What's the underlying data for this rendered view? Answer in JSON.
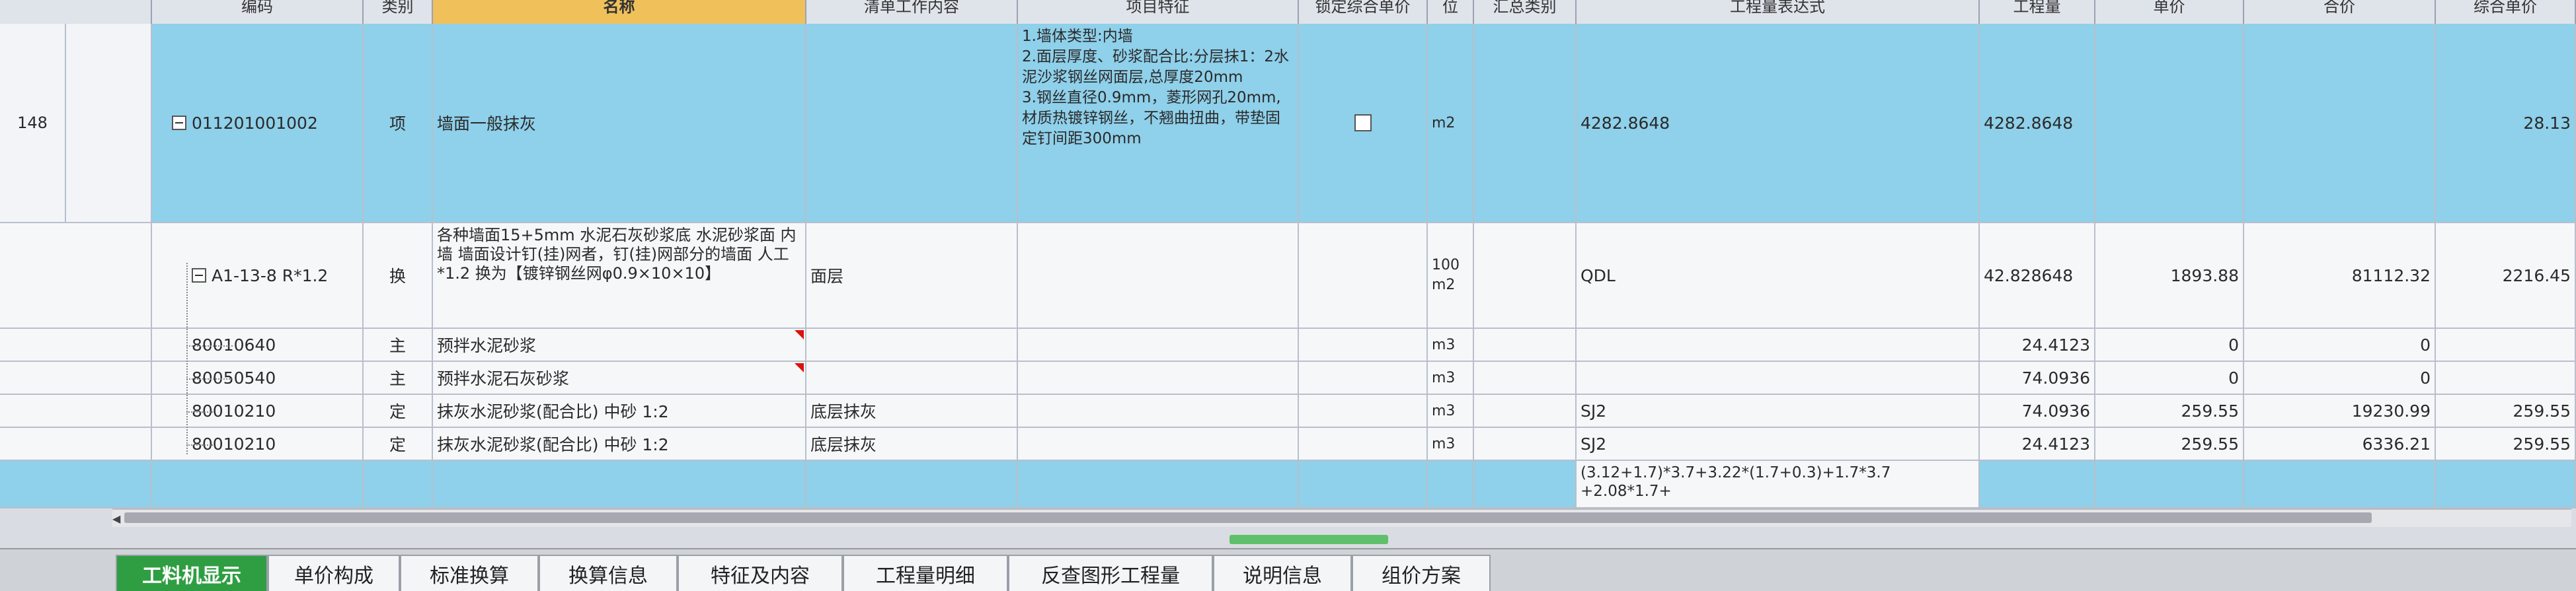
{
  "header": {
    "code": "编码",
    "category": "类别",
    "name": "名称",
    "work_content": "清单工作内容",
    "feature": "项目特征",
    "locked_price": "锁定综合单价",
    "unit": "位",
    "summary_category": "汇总类别",
    "quantity_expr": "工程量表达式",
    "quantity": "工程量",
    "unit_price": "单价",
    "total": "合价",
    "composite_price": "综合单价"
  },
  "rows": [
    {
      "index": "148",
      "code": "011201001002",
      "category": "项",
      "name": "墙面一般抹灰",
      "work_content": "",
      "feature": "1.墙体类型:内墙\n2.面层厚度、砂浆配合比:分层抹1：2水泥沙浆钢丝网面层,总厚度20mm\n3.钢丝直径0.9mm，菱形网孔20mm,材质热镀锌钢丝，不翘曲扭曲，带垫固定钉间距300mm",
      "unit": "m2",
      "quantity_expr": "4282.8648",
      "quantity": "4282.8648",
      "unit_price": "",
      "total": "",
      "composite_price": "28.13"
    },
    {
      "index": "",
      "code": "A1-13-8 R*1.2",
      "category": "换",
      "name": "各种墙面15+5mm 水泥石灰砂浆底 水泥砂浆面 内墙  墙面设计钉(挂)网者，钉(挂)网部分的墙面 人工*1.2  换为【镀锌钢丝网φ0.9×10×10】",
      "work_content": "面层",
      "feature": "",
      "unit": "100\nm2",
      "quantity_expr": "QDL",
      "quantity": "42.828648",
      "unit_price": "1893.88",
      "total": "81112.32",
      "composite_price": "2216.45"
    },
    {
      "index": "",
      "code": "80010640",
      "category": "主",
      "name": "预拌水泥砂浆",
      "work_content": "",
      "feature": "",
      "unit": "m3",
      "quantity_expr": "",
      "quantity": "24.4123",
      "unit_price": "0",
      "total": "0",
      "composite_price": ""
    },
    {
      "index": "",
      "code": "80050540",
      "category": "主",
      "name": "预拌水泥石灰砂浆",
      "work_content": "",
      "feature": "",
      "unit": "m3",
      "quantity_expr": "",
      "quantity": "74.0936",
      "unit_price": "0",
      "total": "0",
      "composite_price": ""
    },
    {
      "index": "",
      "code": "80010210",
      "category": "定",
      "name": "抹灰水泥砂浆(配合比) 中砂 1:2",
      "work_content": "底层抹灰",
      "feature": "",
      "unit": "m3",
      "quantity_expr": "SJ2",
      "quantity": "74.0936",
      "unit_price": "259.55",
      "total": "19230.99",
      "composite_price": "259.55"
    },
    {
      "index": "",
      "code": "80010210",
      "category": "定",
      "name": "抹灰水泥砂浆(配合比) 中砂 1:2",
      "work_content": "底层抹灰",
      "feature": "",
      "unit": "m3",
      "quantity_expr": "SJ2",
      "quantity": "24.4123",
      "unit_price": "259.55",
      "total": "6336.21",
      "composite_price": "259.55"
    },
    {
      "index": "",
      "code": "",
      "category": "",
      "name": "",
      "work_content": "",
      "feature": "",
      "unit": "",
      "quantity_expr": "(3.12+1.7)*3.7+3.22*(1.7+0.3)+1.7*3.7\n+2.08*1.7+",
      "quantity": "",
      "unit_price": "",
      "total": "",
      "composite_price": ""
    }
  ],
  "tabs": [
    {
      "label": "工料机显示",
      "active": true
    },
    {
      "label": "单价构成",
      "active": false
    },
    {
      "label": "标准换算",
      "active": false
    },
    {
      "label": "换算信息",
      "active": false
    },
    {
      "label": "特征及内容",
      "active": false
    },
    {
      "label": "工程量明细",
      "active": false
    },
    {
      "label": "反查图形工程量",
      "active": false
    },
    {
      "label": "说明信息",
      "active": false
    },
    {
      "label": "组价方案",
      "active": false
    }
  ],
  "colors": {
    "selected_row": "#8fd0ea",
    "header_highlight": "#f0c15b",
    "active_tab": "#2f9e42"
  }
}
